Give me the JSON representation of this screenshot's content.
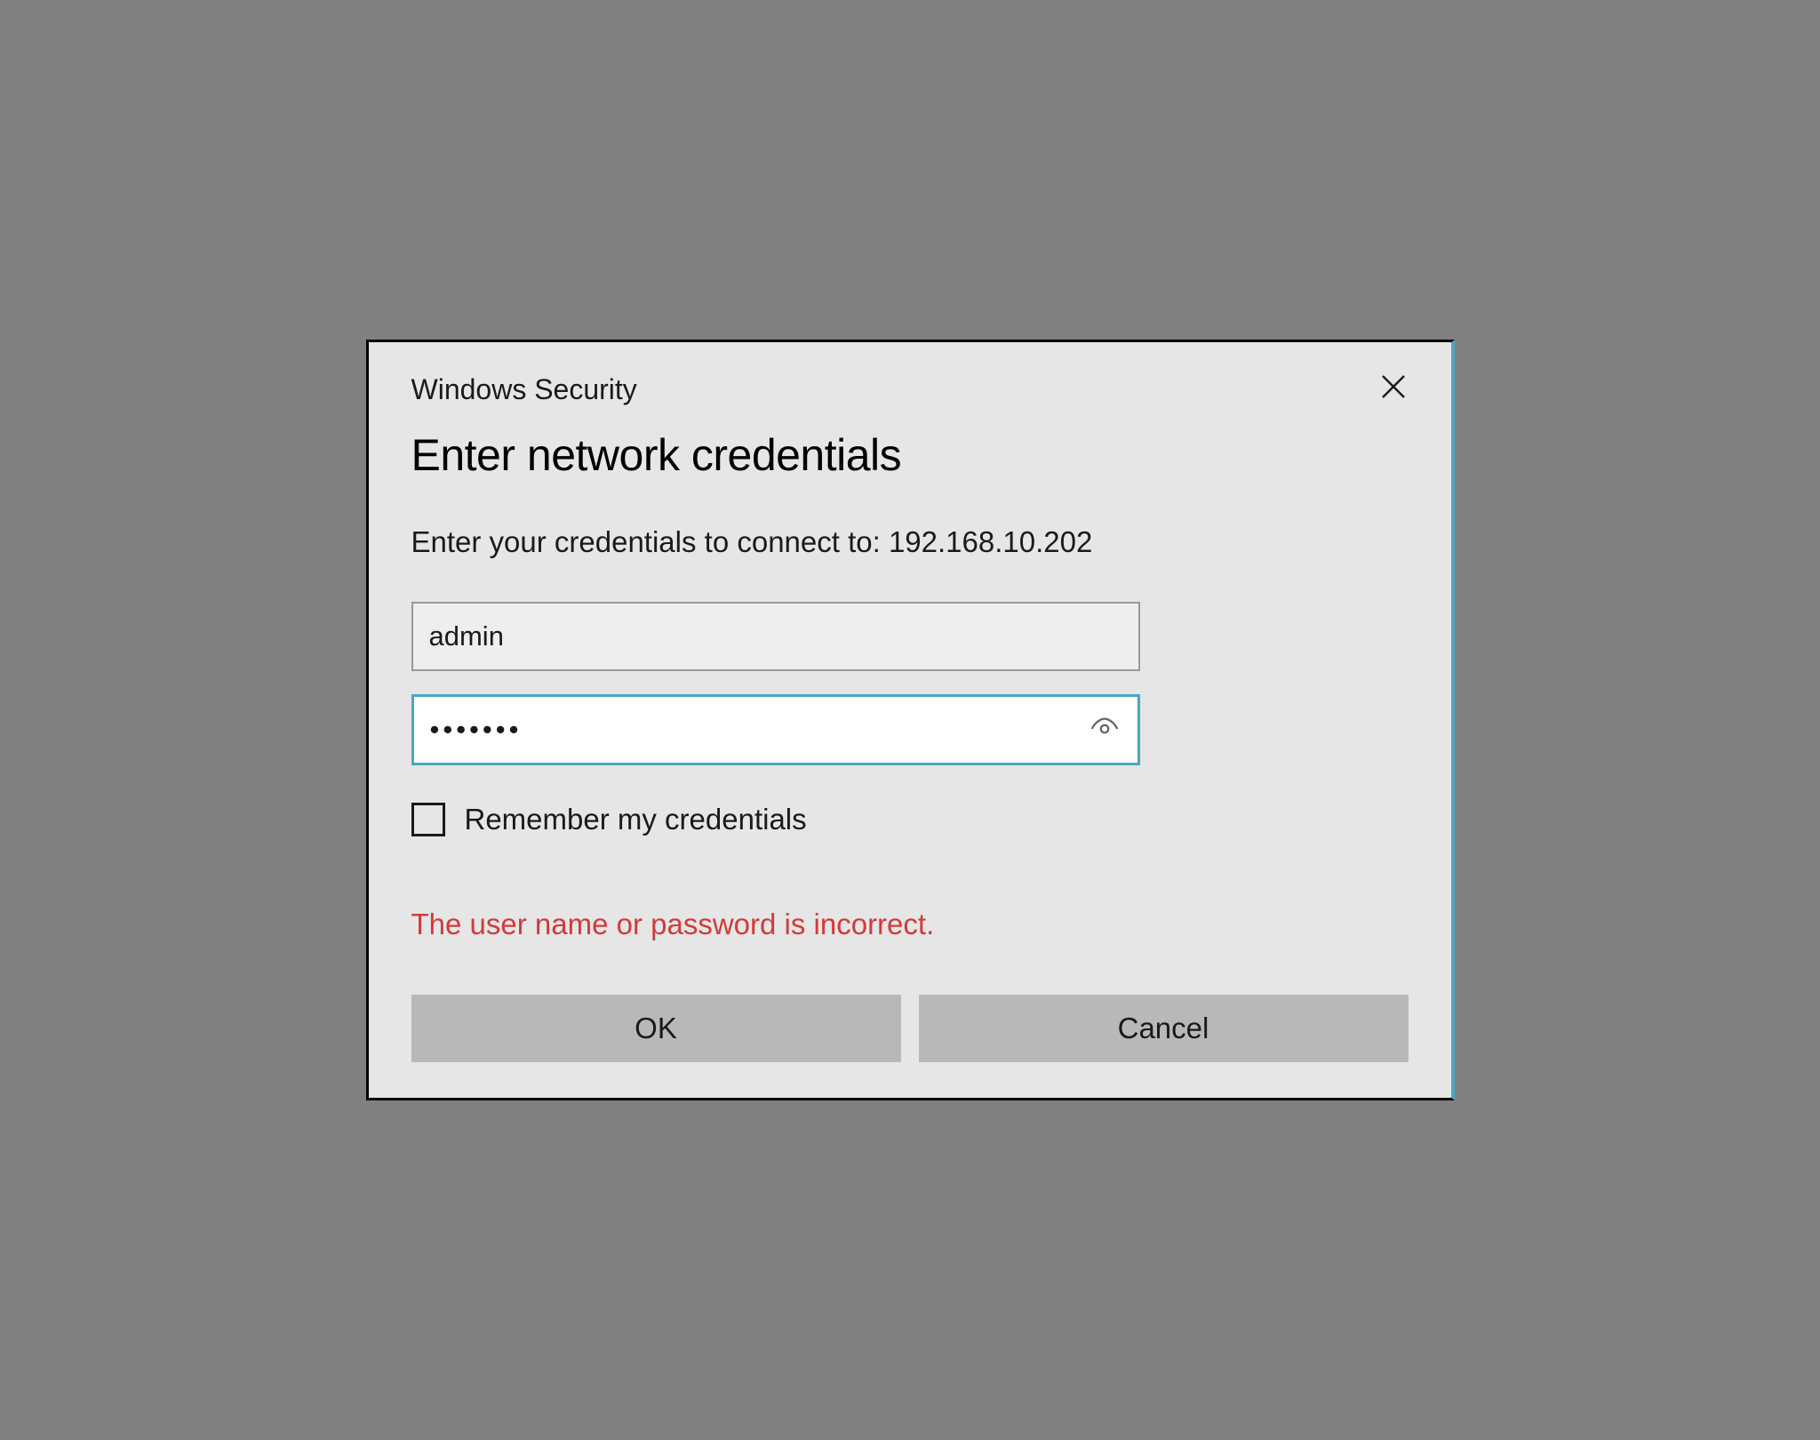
{
  "dialog": {
    "title": "Windows Security",
    "heading": "Enter network credentials",
    "subtext": "Enter your credentials to connect to: 192.168.10.202",
    "username_value": "admin",
    "password_value": "•••••••",
    "remember_label": "Remember my credentials",
    "remember_checked": false,
    "error_message": "The user name or password is incorrect.",
    "ok_label": "OK",
    "cancel_label": "Cancel"
  },
  "colors": {
    "accent": "#4aa7c4",
    "error": "#d13b3b",
    "dialog_bg": "#e6e6e6",
    "button_bg": "#b8b8b8"
  }
}
